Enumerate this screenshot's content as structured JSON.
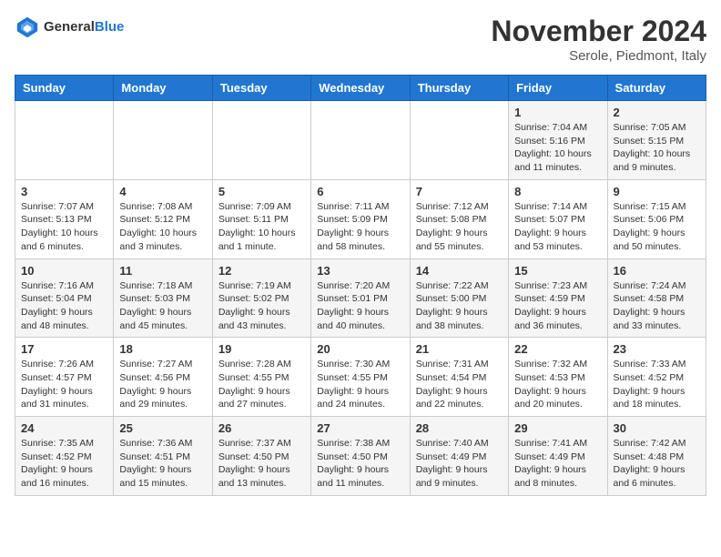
{
  "header": {
    "logo_general": "General",
    "logo_blue": "Blue",
    "month_title": "November 2024",
    "location": "Serole, Piedmont, Italy"
  },
  "days_of_week": [
    "Sunday",
    "Monday",
    "Tuesday",
    "Wednesday",
    "Thursday",
    "Friday",
    "Saturday"
  ],
  "weeks": [
    [
      {
        "day": "",
        "info": ""
      },
      {
        "day": "",
        "info": ""
      },
      {
        "day": "",
        "info": ""
      },
      {
        "day": "",
        "info": ""
      },
      {
        "day": "",
        "info": ""
      },
      {
        "day": "1",
        "info": "Sunrise: 7:04 AM\nSunset: 5:16 PM\nDaylight: 10 hours and 11 minutes."
      },
      {
        "day": "2",
        "info": "Sunrise: 7:05 AM\nSunset: 5:15 PM\nDaylight: 10 hours and 9 minutes."
      }
    ],
    [
      {
        "day": "3",
        "info": "Sunrise: 7:07 AM\nSunset: 5:13 PM\nDaylight: 10 hours and 6 minutes."
      },
      {
        "day": "4",
        "info": "Sunrise: 7:08 AM\nSunset: 5:12 PM\nDaylight: 10 hours and 3 minutes."
      },
      {
        "day": "5",
        "info": "Sunrise: 7:09 AM\nSunset: 5:11 PM\nDaylight: 10 hours and 1 minute."
      },
      {
        "day": "6",
        "info": "Sunrise: 7:11 AM\nSunset: 5:09 PM\nDaylight: 9 hours and 58 minutes."
      },
      {
        "day": "7",
        "info": "Sunrise: 7:12 AM\nSunset: 5:08 PM\nDaylight: 9 hours and 55 minutes."
      },
      {
        "day": "8",
        "info": "Sunrise: 7:14 AM\nSunset: 5:07 PM\nDaylight: 9 hours and 53 minutes."
      },
      {
        "day": "9",
        "info": "Sunrise: 7:15 AM\nSunset: 5:06 PM\nDaylight: 9 hours and 50 minutes."
      }
    ],
    [
      {
        "day": "10",
        "info": "Sunrise: 7:16 AM\nSunset: 5:04 PM\nDaylight: 9 hours and 48 minutes."
      },
      {
        "day": "11",
        "info": "Sunrise: 7:18 AM\nSunset: 5:03 PM\nDaylight: 9 hours and 45 minutes."
      },
      {
        "day": "12",
        "info": "Sunrise: 7:19 AM\nSunset: 5:02 PM\nDaylight: 9 hours and 43 minutes."
      },
      {
        "day": "13",
        "info": "Sunrise: 7:20 AM\nSunset: 5:01 PM\nDaylight: 9 hours and 40 minutes."
      },
      {
        "day": "14",
        "info": "Sunrise: 7:22 AM\nSunset: 5:00 PM\nDaylight: 9 hours and 38 minutes."
      },
      {
        "day": "15",
        "info": "Sunrise: 7:23 AM\nSunset: 4:59 PM\nDaylight: 9 hours and 36 minutes."
      },
      {
        "day": "16",
        "info": "Sunrise: 7:24 AM\nSunset: 4:58 PM\nDaylight: 9 hours and 33 minutes."
      }
    ],
    [
      {
        "day": "17",
        "info": "Sunrise: 7:26 AM\nSunset: 4:57 PM\nDaylight: 9 hours and 31 minutes."
      },
      {
        "day": "18",
        "info": "Sunrise: 7:27 AM\nSunset: 4:56 PM\nDaylight: 9 hours and 29 minutes."
      },
      {
        "day": "19",
        "info": "Sunrise: 7:28 AM\nSunset: 4:55 PM\nDaylight: 9 hours and 27 minutes."
      },
      {
        "day": "20",
        "info": "Sunrise: 7:30 AM\nSunset: 4:55 PM\nDaylight: 9 hours and 24 minutes."
      },
      {
        "day": "21",
        "info": "Sunrise: 7:31 AM\nSunset: 4:54 PM\nDaylight: 9 hours and 22 minutes."
      },
      {
        "day": "22",
        "info": "Sunrise: 7:32 AM\nSunset: 4:53 PM\nDaylight: 9 hours and 20 minutes."
      },
      {
        "day": "23",
        "info": "Sunrise: 7:33 AM\nSunset: 4:52 PM\nDaylight: 9 hours and 18 minutes."
      }
    ],
    [
      {
        "day": "24",
        "info": "Sunrise: 7:35 AM\nSunset: 4:52 PM\nDaylight: 9 hours and 16 minutes."
      },
      {
        "day": "25",
        "info": "Sunrise: 7:36 AM\nSunset: 4:51 PM\nDaylight: 9 hours and 15 minutes."
      },
      {
        "day": "26",
        "info": "Sunrise: 7:37 AM\nSunset: 4:50 PM\nDaylight: 9 hours and 13 minutes."
      },
      {
        "day": "27",
        "info": "Sunrise: 7:38 AM\nSunset: 4:50 PM\nDaylight: 9 hours and 11 minutes."
      },
      {
        "day": "28",
        "info": "Sunrise: 7:40 AM\nSunset: 4:49 PM\nDaylight: 9 hours and 9 minutes."
      },
      {
        "day": "29",
        "info": "Sunrise: 7:41 AM\nSunset: 4:49 PM\nDaylight: 9 hours and 8 minutes."
      },
      {
        "day": "30",
        "info": "Sunrise: 7:42 AM\nSunset: 4:48 PM\nDaylight: 9 hours and 6 minutes."
      }
    ]
  ]
}
